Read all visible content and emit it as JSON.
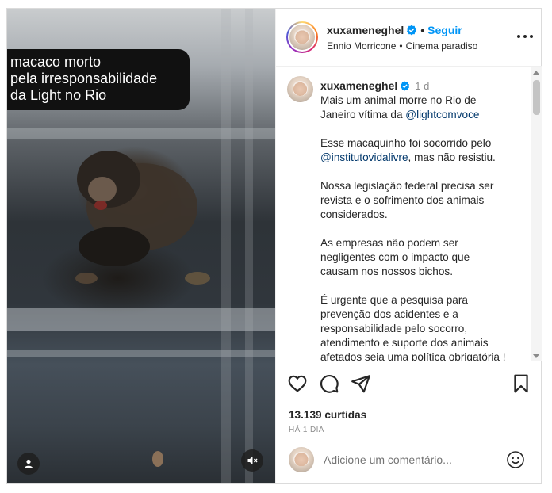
{
  "media": {
    "overlay_lines": [
      "macaco morto",
      "pela irresponsabilidade",
      "da Light no Rio"
    ],
    "user_tag_icon": "user-icon",
    "mute_icon": "speaker-muted-icon"
  },
  "header": {
    "username": "xuxameneghel",
    "verified": true,
    "separator": "•",
    "follow_label": "Seguir",
    "audio_artist": "Ennio Morricone",
    "audio_title": "Cinema paradiso",
    "more_icon": "more-options-icon"
  },
  "caption": {
    "username": "xuxameneghel",
    "time": "1 d",
    "paragraphs": [
      {
        "lines": [
          [
            {
              "t": "Mais um animal morre no Rio de"
            }
          ],
          [
            {
              "t": "Janeiro vítima da "
            },
            {
              "t": "@lightcomvoce",
              "m": true
            }
          ]
        ]
      },
      {
        "lines": [
          [
            {
              "t": "Esse macaquinho foi socorrido pelo"
            }
          ],
          [
            {
              "t": "@institutovidalivre",
              "m": true
            },
            {
              "t": ", mas não resistiu."
            }
          ]
        ]
      },
      {
        "lines": [
          [
            {
              "t": "Nossa legislação federal precisa ser"
            }
          ],
          [
            {
              "t": "revista e o sofrimento dos animais"
            }
          ],
          [
            {
              "t": "considerados."
            }
          ]
        ]
      },
      {
        "lines": [
          [
            {
              "t": "As empresas não podem ser"
            }
          ],
          [
            {
              "t": "negligentes com o impacto que"
            }
          ],
          [
            {
              "t": "causam nos nossos bichos."
            }
          ]
        ]
      },
      {
        "lines": [
          [
            {
              "t": "É urgente que a pesquisa para"
            }
          ],
          [
            {
              "t": "prevenção dos acidentes e a"
            }
          ],
          [
            {
              "t": "responsabilidade pelo socorro,"
            }
          ],
          [
            {
              "t": "atendimento e suporte dos animais"
            }
          ],
          [
            {
              "t": "afetados seja uma política obrigatória !"
            }
          ]
        ]
      }
    ]
  },
  "actions": {
    "like_icon": "heart-icon",
    "comment_icon": "comment-icon",
    "share_icon": "share-icon",
    "save_icon": "bookmark-icon",
    "likes": "13.139 curtidas",
    "posted_ago": "HÁ 1 DIA"
  },
  "add_comment": {
    "placeholder": "Adicione um comentário...",
    "emoji_icon": "emoji-icon"
  },
  "colors": {
    "link": "#0095f6",
    "mention": "#00376b",
    "verified": "#0095f6",
    "muted_text": "#8e8e8e"
  }
}
